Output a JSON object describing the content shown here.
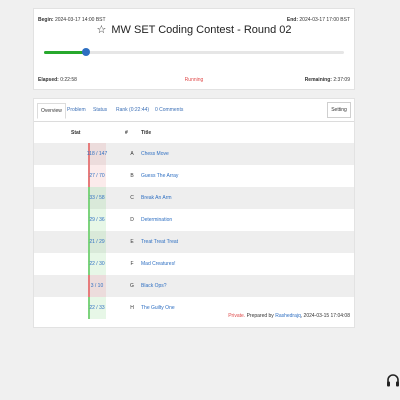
{
  "contest": {
    "begin_label": "Begin:",
    "begin_time": "2024-03-17 14:00 BST",
    "end_label": "End:",
    "end_time": "2024-03-17 17:00 BST",
    "star_icon": "star-icon",
    "title": "MW SET Coding Contest - Round 02",
    "progress_fraction": 0.14,
    "elapsed_label": "Elapsed:",
    "elapsed_value": "0:22:58",
    "status": "Running",
    "remaining_label": "Remaining:",
    "remaining_value": "2:37:09"
  },
  "tabs": [
    {
      "label": "Overview"
    },
    {
      "label": "Problem"
    },
    {
      "label": "Status"
    },
    {
      "label": "Rank (0:22:44)"
    },
    {
      "label": "0 Comments"
    }
  ],
  "setting_label": "Setting",
  "table": {
    "headers": {
      "stat": "Stat",
      "index": "#",
      "title": "Title"
    },
    "rows": [
      {
        "stat": "118 / 147",
        "index": "A",
        "title": "Chess Move"
      },
      {
        "stat": "27 / 70",
        "index": "B",
        "title": "Guess The Array"
      },
      {
        "stat": "33 / 58",
        "index": "C",
        "title": "Break An Arm"
      },
      {
        "stat": "29 / 36",
        "index": "D",
        "title": "Determination"
      },
      {
        "stat": "21 / 29",
        "index": "E",
        "title": "Treat Treat Treat"
      },
      {
        "stat": "22 / 30",
        "index": "F",
        "title": "Mad Creatures!"
      },
      {
        "stat": "3 / 10",
        "index": "G",
        "title": "Black Ops?"
      },
      {
        "stat": "22 / 33",
        "index": "H",
        "title": "The Guilty One"
      }
    ]
  },
  "footer": {
    "private_label": "Private.",
    "prepared_by": "Prepared by",
    "author": "Rashedrajq",
    "date": ", 2024-03-15 17:04:08"
  },
  "colors": {
    "accent": "#2e6fc2",
    "progress": "#27a82d",
    "running": "#e04b4b"
  }
}
